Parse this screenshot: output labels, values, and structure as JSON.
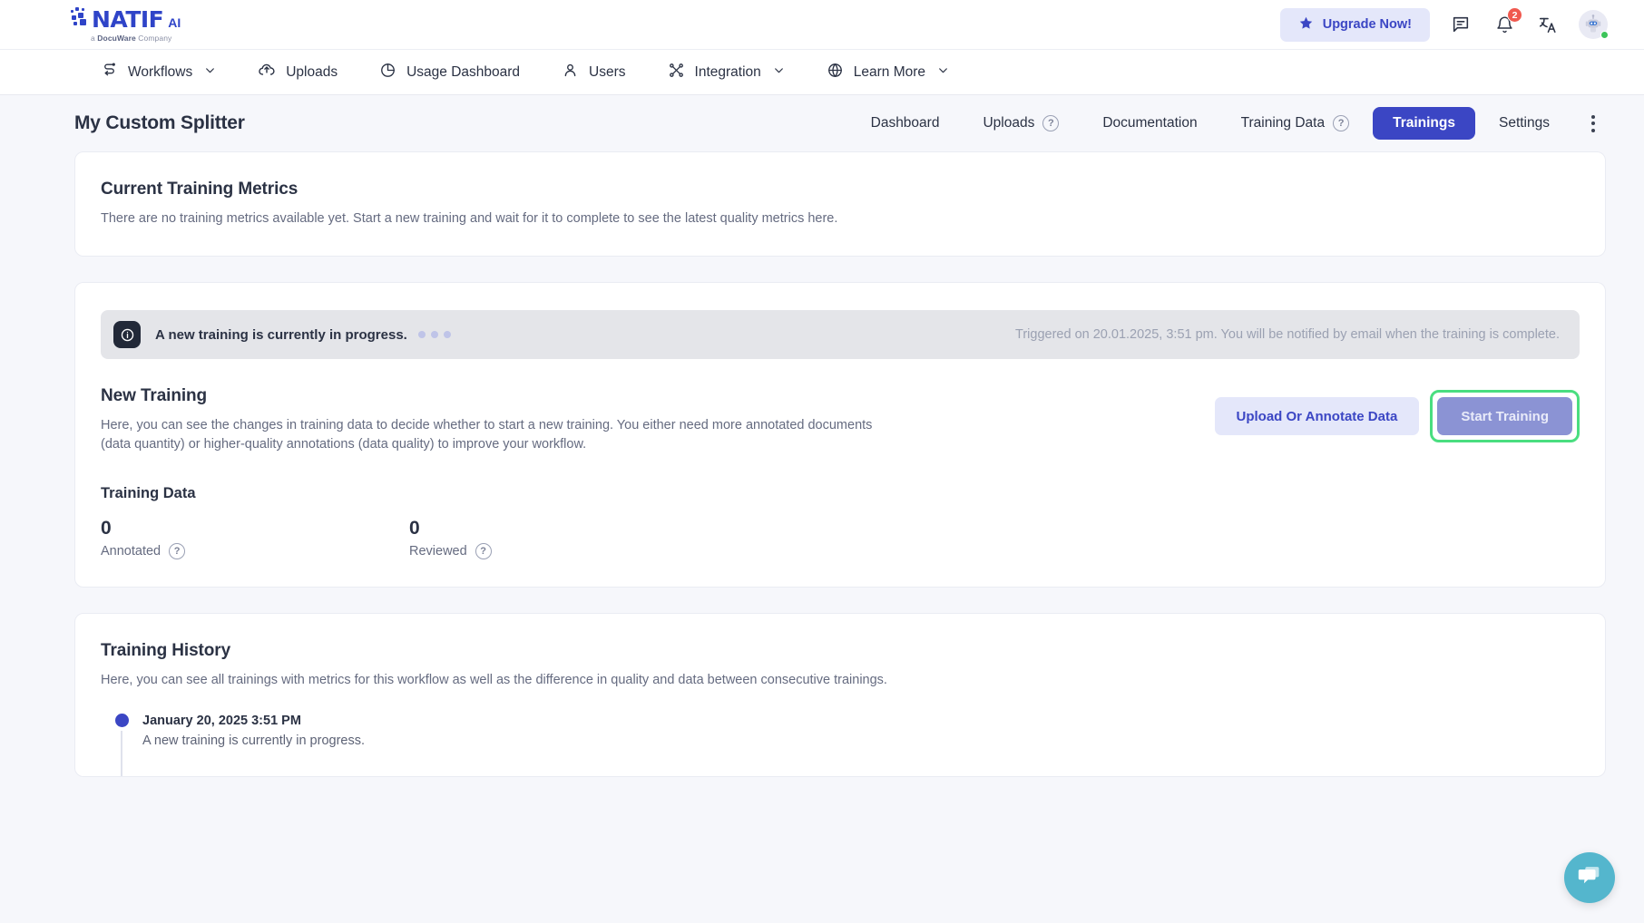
{
  "brand": {
    "name": "NATIF",
    "suffix": "AI",
    "tagline_prefix": "a ",
    "tagline_bold": "DocuWare",
    "tagline_suffix": " Company"
  },
  "header": {
    "upgrade_label": "Upgrade Now!",
    "star_icon": "star-icon",
    "message_icon": "message-icon",
    "bell_icon": "bell-icon",
    "notification_count": "2",
    "translate_icon": "translate-icon",
    "avatar_icon": "robot-avatar-icon",
    "status_color": "#3cc45a"
  },
  "nav": {
    "items": [
      {
        "label": "Workflows",
        "icon": "workflows-icon",
        "has_chevron": true
      },
      {
        "label": "Uploads",
        "icon": "cloud-upload-icon",
        "has_chevron": false
      },
      {
        "label": "Usage Dashboard",
        "icon": "pie-chart-icon",
        "has_chevron": false
      },
      {
        "label": "Users",
        "icon": "user-icon",
        "has_chevron": false
      },
      {
        "label": "Integration",
        "icon": "integration-nodes-icon",
        "has_chevron": true
      },
      {
        "label": "Learn More",
        "icon": "globe-icon",
        "has_chevron": true
      }
    ]
  },
  "page": {
    "title": "My Custom Splitter",
    "tabs": [
      {
        "label": "Dashboard",
        "active": false,
        "help": false
      },
      {
        "label": "Uploads",
        "active": false,
        "help": true
      },
      {
        "label": "Documentation",
        "active": false,
        "help": false
      },
      {
        "label": "Training Data",
        "active": false,
        "help": true
      },
      {
        "label": "Trainings",
        "active": true,
        "help": false
      },
      {
        "label": "Settings",
        "active": false,
        "help": false
      }
    ],
    "more_menu_icon": "kebab-menu-icon",
    "active_tab_color": "#3b46c4"
  },
  "metrics_card": {
    "title": "Current Training Metrics",
    "description": "There are no training metrics available yet. Start a new training and wait for it to complete to see the latest quality metrics here."
  },
  "training_banner": {
    "icon": "info-icon",
    "message": "A new training is currently in progress.",
    "meta": "Triggered on 20.01.2025, 3:51 pm. You will be notified by email when the training is complete."
  },
  "new_training": {
    "title": "New Training",
    "description": "Here, you can see the changes in training data to decide whether to start a new training. You either need more annotated documents (data quantity) or higher-quality annotations (data quality) to improve your workflow.",
    "upload_button": "Upload Or Annotate Data",
    "start_button": "Start Training",
    "start_button_highlight_color": "#4ade80",
    "training_data_label": "Training Data",
    "stats": [
      {
        "value": "0",
        "label": "Annotated",
        "help": true
      },
      {
        "value": "0",
        "label": "Reviewed",
        "help": true
      }
    ]
  },
  "training_history": {
    "title": "Training History",
    "description": "Here, you can see all trainings with metrics for this workflow as well as the difference in quality and data between consecutive trainings.",
    "entries": [
      {
        "date": "January 20, 2025 3:51 PM",
        "description": "A new training is currently in progress.",
        "dot_color": "#3b46c4"
      }
    ]
  },
  "chat_widget": {
    "icon": "chat-bubbles-icon",
    "color": "#54b6cd"
  }
}
